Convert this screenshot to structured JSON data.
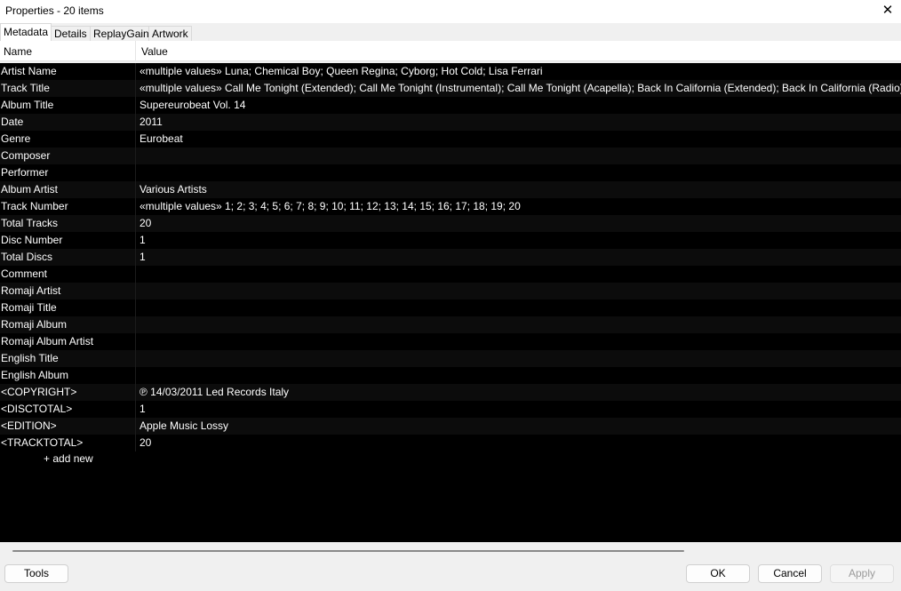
{
  "window": {
    "title": "Properties - 20 items",
    "close_icon": "close-icon"
  },
  "tabs": [
    "Metadata",
    "Details",
    "ReplayGain",
    "Artwork"
  ],
  "columns": {
    "name": "Name",
    "value": "Value"
  },
  "rows": [
    {
      "name": "Artist Name",
      "value": "«multiple values» Luna; Chemical Boy; Queen Regina; Cyborg; Hot Cold; Lisa Ferrari"
    },
    {
      "name": "Track Title",
      "value": "«multiple values» Call Me Tonight (Extended); Call Me Tonight (Instrumental); Call Me Tonight (Acapella); Back In California (Extended); Back In California (Radio); B"
    },
    {
      "name": "Album Title",
      "value": "Supereurobeat Vol. 14"
    },
    {
      "name": "Date",
      "value": "2011"
    },
    {
      "name": "Genre",
      "value": "Eurobeat"
    },
    {
      "name": "Composer",
      "value": ""
    },
    {
      "name": "Performer",
      "value": ""
    },
    {
      "name": "Album Artist",
      "value": "Various Artists"
    },
    {
      "name": "Track Number",
      "value": "«multiple values» 1; 2; 3; 4; 5; 6; 7; 8; 9; 10; 11; 12; 13; 14; 15; 16; 17; 18; 19; 20"
    },
    {
      "name": "Total Tracks",
      "value": "20"
    },
    {
      "name": "Disc Number",
      "value": "1"
    },
    {
      "name": "Total Discs",
      "value": "1"
    },
    {
      "name": "Comment",
      "value": ""
    },
    {
      "name": "Romaji Artist",
      "value": ""
    },
    {
      "name": "Romaji Title",
      "value": ""
    },
    {
      "name": "Romaji Album",
      "value": ""
    },
    {
      "name": "Romaji Album Artist",
      "value": ""
    },
    {
      "name": "English Title",
      "value": ""
    },
    {
      "name": "English Album",
      "value": ""
    },
    {
      "name": "<COPYRIGHT>",
      "value": "℗ 14/03/2011 Led Records Italy"
    },
    {
      "name": "<DISCTOTAL>",
      "value": "1"
    },
    {
      "name": "<EDITION>",
      "value": "Apple Music Lossy"
    },
    {
      "name": "<TRACKTOTAL>",
      "value": "20"
    }
  ],
  "add_new_label": "+ add new",
  "buttons": {
    "tools": "Tools",
    "ok": "OK",
    "cancel": "Cancel",
    "apply": "Apply"
  }
}
